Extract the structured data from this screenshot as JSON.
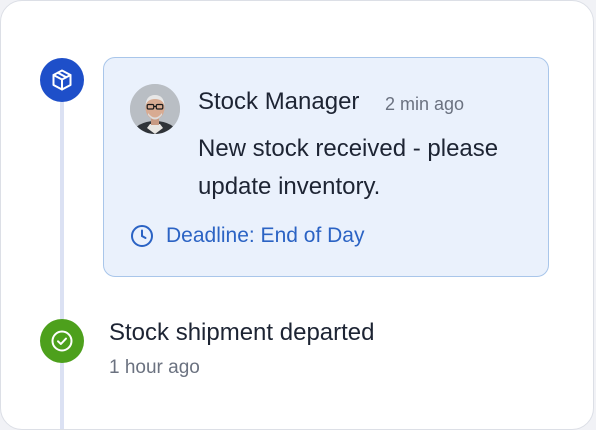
{
  "timeline": {
    "items": [
      {
        "icon": "package-icon",
        "icon_color": "#1e4fc9",
        "comment": {
          "author": "Stock Manager",
          "time": "2 min ago",
          "message": "New stock received - please update inventory.",
          "deadline_icon": "clock-icon",
          "deadline": "Deadline: End of Day"
        }
      },
      {
        "icon": "check-circle-icon",
        "icon_color": "#4da01c",
        "title": "Stock shipment departed",
        "time": "1 hour ago"
      }
    ]
  },
  "colors": {
    "card_background": "#eaf1fc",
    "card_border": "#a9c6ea",
    "link_blue": "#2b63c4",
    "timeline_line": "#dbe1f3"
  }
}
